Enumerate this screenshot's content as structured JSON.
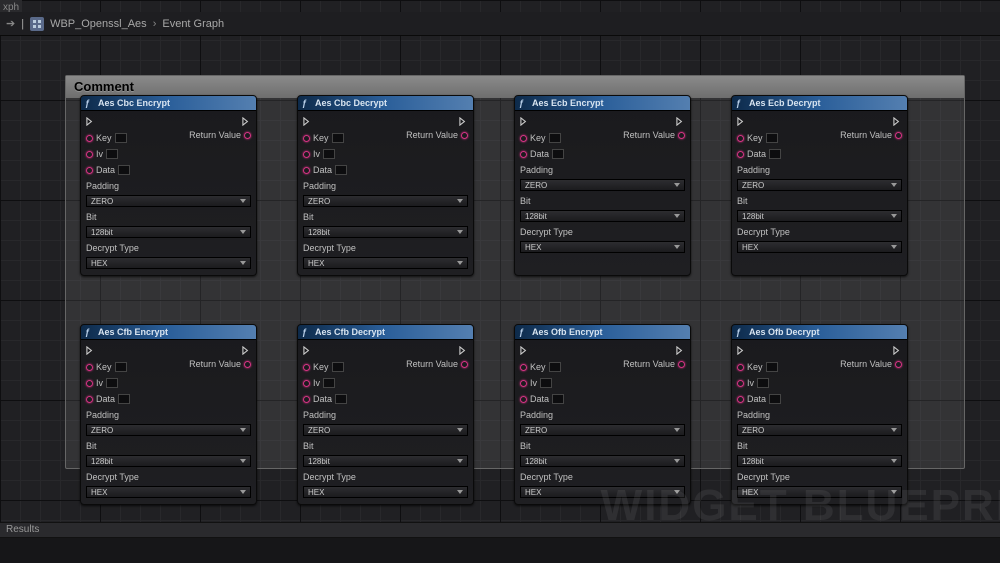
{
  "top_label": "xph",
  "breadcrumb": {
    "parent": "WBP_Openssl_Aes",
    "current": "Event Graph"
  },
  "comment": {
    "title": "Comment"
  },
  "watermark": "WIDGET BLUEPRI",
  "results": "Results",
  "pins": {
    "key": "Key",
    "iv": "Iv",
    "data": "Data",
    "return": "Return Value"
  },
  "fields": {
    "padding": "Padding",
    "bit": "Bit",
    "decrypt_type": "Decrypt Type"
  },
  "values": {
    "zero": "ZERO",
    "b128": "128bit",
    "hex": "HEX"
  },
  "nodes": [
    {
      "title": "Aes Cbc Encrypt",
      "has_iv": true
    },
    {
      "title": "Aes Cbc Decrypt",
      "has_iv": true
    },
    {
      "title": "Aes Ecb Encrypt",
      "has_iv": false
    },
    {
      "title": "Aes Ecb Decrypt",
      "has_iv": false
    },
    {
      "title": "Aes Cfb Encrypt",
      "has_iv": true
    },
    {
      "title": "Aes Cfb Decrypt",
      "has_iv": true
    },
    {
      "title": "Aes Ofb Encrypt",
      "has_iv": true
    },
    {
      "title": "Aes Ofb Decrypt",
      "has_iv": true
    }
  ]
}
